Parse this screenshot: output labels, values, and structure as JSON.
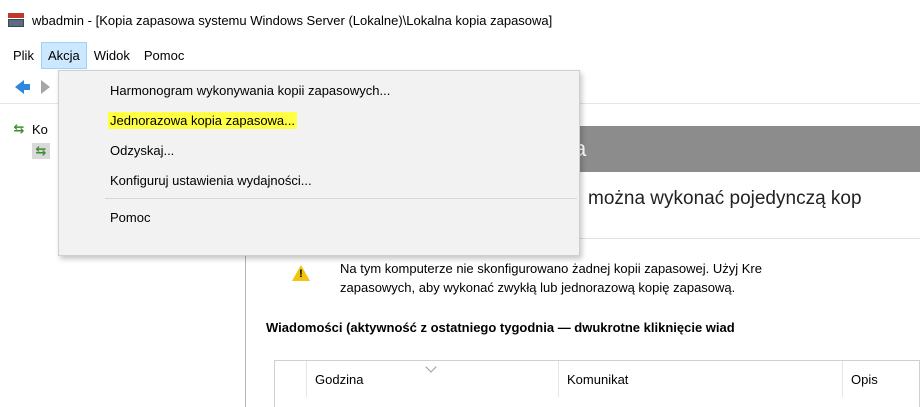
{
  "window": {
    "title": "wbadmin - [Kopia zapasowa systemu Windows Server (Lokalne)\\Lokalna kopia zapasowa]",
    "app_icon": "server-backup-icon"
  },
  "menubar": {
    "items": [
      {
        "label": "Plik"
      },
      {
        "label": "Akcja"
      },
      {
        "label": "Widok"
      },
      {
        "label": "Pomoc"
      }
    ],
    "active": "Akcja"
  },
  "toolbar": {
    "back_icon": "back-arrow-icon",
    "forward_icon": "forward-arrow-icon"
  },
  "tree": {
    "root_label": "Ko",
    "child_label": ""
  },
  "action_menu": {
    "items": [
      {
        "label": "Harmonogram wykonywania kopii zapasowych..."
      },
      {
        "label": "Jednorazowa kopia zapasowa..."
      },
      {
        "label": "Odzyskaj..."
      },
      {
        "label": "Konfiguruj ustawienia wydajności..."
      },
      {
        "label": "Pomoc"
      }
    ],
    "highlight_color": "#ffff44"
  },
  "main": {
    "banner_text": "a",
    "subtitle": "można wykonać pojedynczą kop",
    "warning": {
      "line1": "Na tym komputerze nie skonfigurowano żadnej kopii zapasowej. Użyj Kre",
      "line2": "zapasowych, aby wykonać zwykłą lub jednorazową kopię zapasową."
    },
    "messages_header": "Wiadomości (aktywność z ostatniego tygodnia — dwukrotne kliknięcie wiad",
    "columns": [
      {
        "label": ""
      },
      {
        "label": "Godzina"
      },
      {
        "label": "Komunikat"
      },
      {
        "label": "Opis"
      }
    ]
  },
  "colors": {
    "menu_active_bg": "#cce8ff",
    "banner_bg": "#8c8c8c",
    "warning": "#f1c40f"
  }
}
